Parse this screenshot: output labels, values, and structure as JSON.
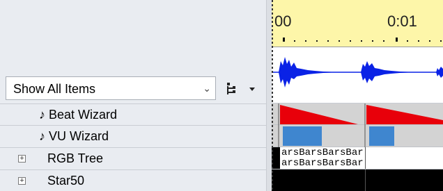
{
  "filter": {
    "selected": "Show All Items",
    "chevron": "chevron-down-icon"
  },
  "toolbar": {
    "tree_icon": "tree-view-icon",
    "dropdown_icon": "small-down-arrow-icon"
  },
  "rows": [
    {
      "label": "♪ Beat Wizard",
      "expander": ""
    },
    {
      "label": "♪ VU Wizard",
      "expander": ""
    },
    {
      "label": "RGB Tree",
      "expander": "+"
    },
    {
      "label": "Star50",
      "expander": "+"
    }
  ],
  "timeline": {
    "labels": [
      "00",
      "0:01"
    ],
    "effect_text_top": "arsBarsBarsBar",
    "effect_text_bottom": "arsBarsBarsBar",
    "colors": {
      "ruler": "#fdf6a9",
      "waveform": "#0a22e6",
      "beat": "#e8000a",
      "vu": "#3f86cf"
    }
  }
}
